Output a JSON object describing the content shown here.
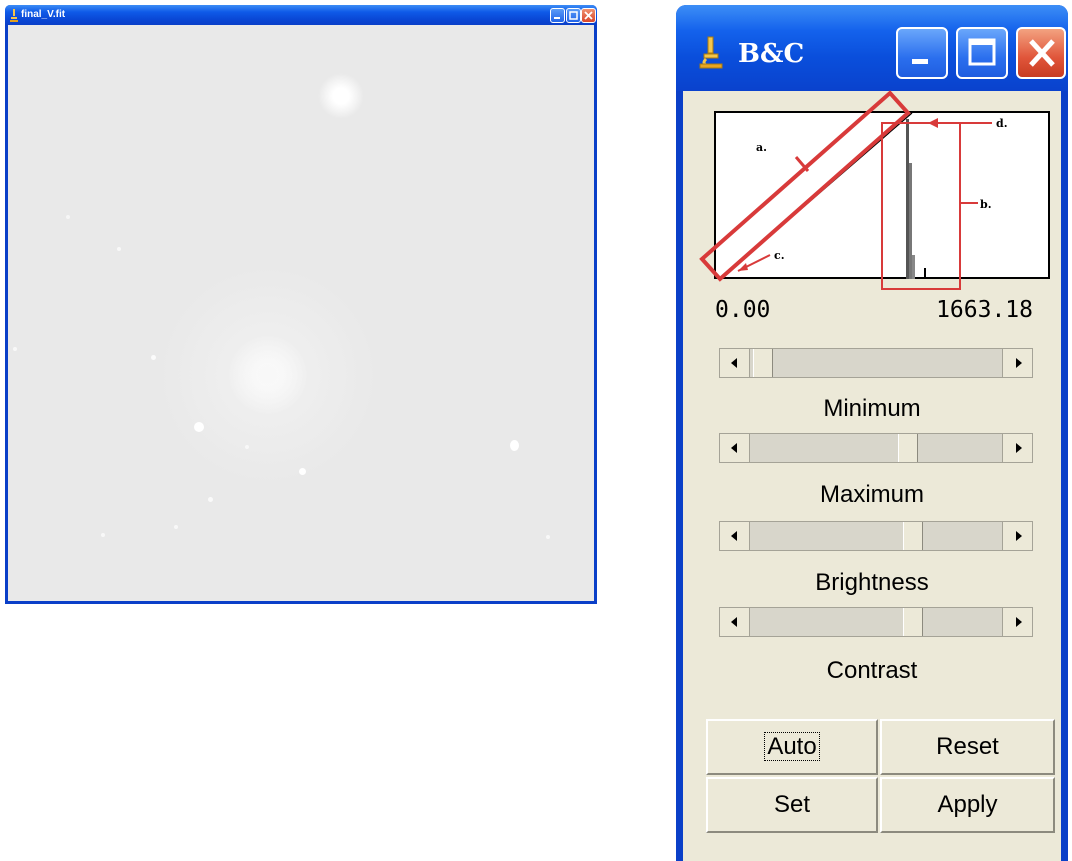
{
  "image_window": {
    "title": "final_V.fit",
    "buttons": [
      "minimize",
      "maximize",
      "close"
    ],
    "background_color": "#e9e9e9"
  },
  "bc_window": {
    "title": "B&C",
    "histogram": {
      "annotations": [
        "a.",
        "b.",
        "c.",
        "d."
      ]
    },
    "range_min": "0.00",
    "range_max": "1663.18",
    "sliders": [
      {
        "label": "Minimum",
        "value_fraction": 0.0
      },
      {
        "label": "Maximum",
        "value_fraction": 0.62
      },
      {
        "label": "Brightness",
        "value_fraction": 0.64
      },
      {
        "label": "Contrast",
        "value_fraction": 0.64
      }
    ],
    "buttons": {
      "auto": "Auto",
      "reset": "Reset",
      "set": "Set",
      "apply": "Apply"
    },
    "accent_color": "#d83a3a"
  }
}
